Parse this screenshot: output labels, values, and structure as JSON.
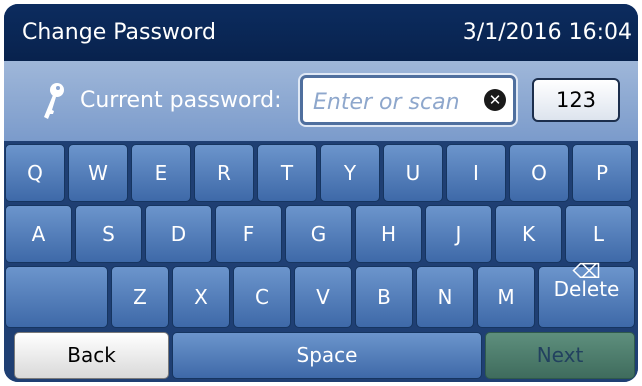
{
  "header": {
    "title": "Change Password",
    "datetime": "3/1/2016 16:04"
  },
  "entry": {
    "label": "Current password:",
    "placeholder": "Enter or scan",
    "value": "",
    "clear_symbol": "✕",
    "mode_label": "123",
    "icon": "key-icon"
  },
  "keyboard": {
    "row1": [
      "Q",
      "W",
      "E",
      "R",
      "T",
      "Y",
      "U",
      "I",
      "O",
      "P"
    ],
    "row2": [
      "A",
      "S",
      "D",
      "F",
      "G",
      "H",
      "J",
      "K",
      "L"
    ],
    "row3": [
      "Z",
      "X",
      "C",
      "V",
      "B",
      "N",
      "M"
    ],
    "delete_label": "Delete",
    "delete_symbol": "⌫",
    "back_label": "Back",
    "space_label": "Space",
    "next_label": "Next"
  },
  "colors": {
    "titlebar": "#0c2c5f",
    "entry_band": "#8eaad6",
    "key": "#5581bf",
    "next_key": "#4f7f6e",
    "back_key": "#eeeeee"
  }
}
